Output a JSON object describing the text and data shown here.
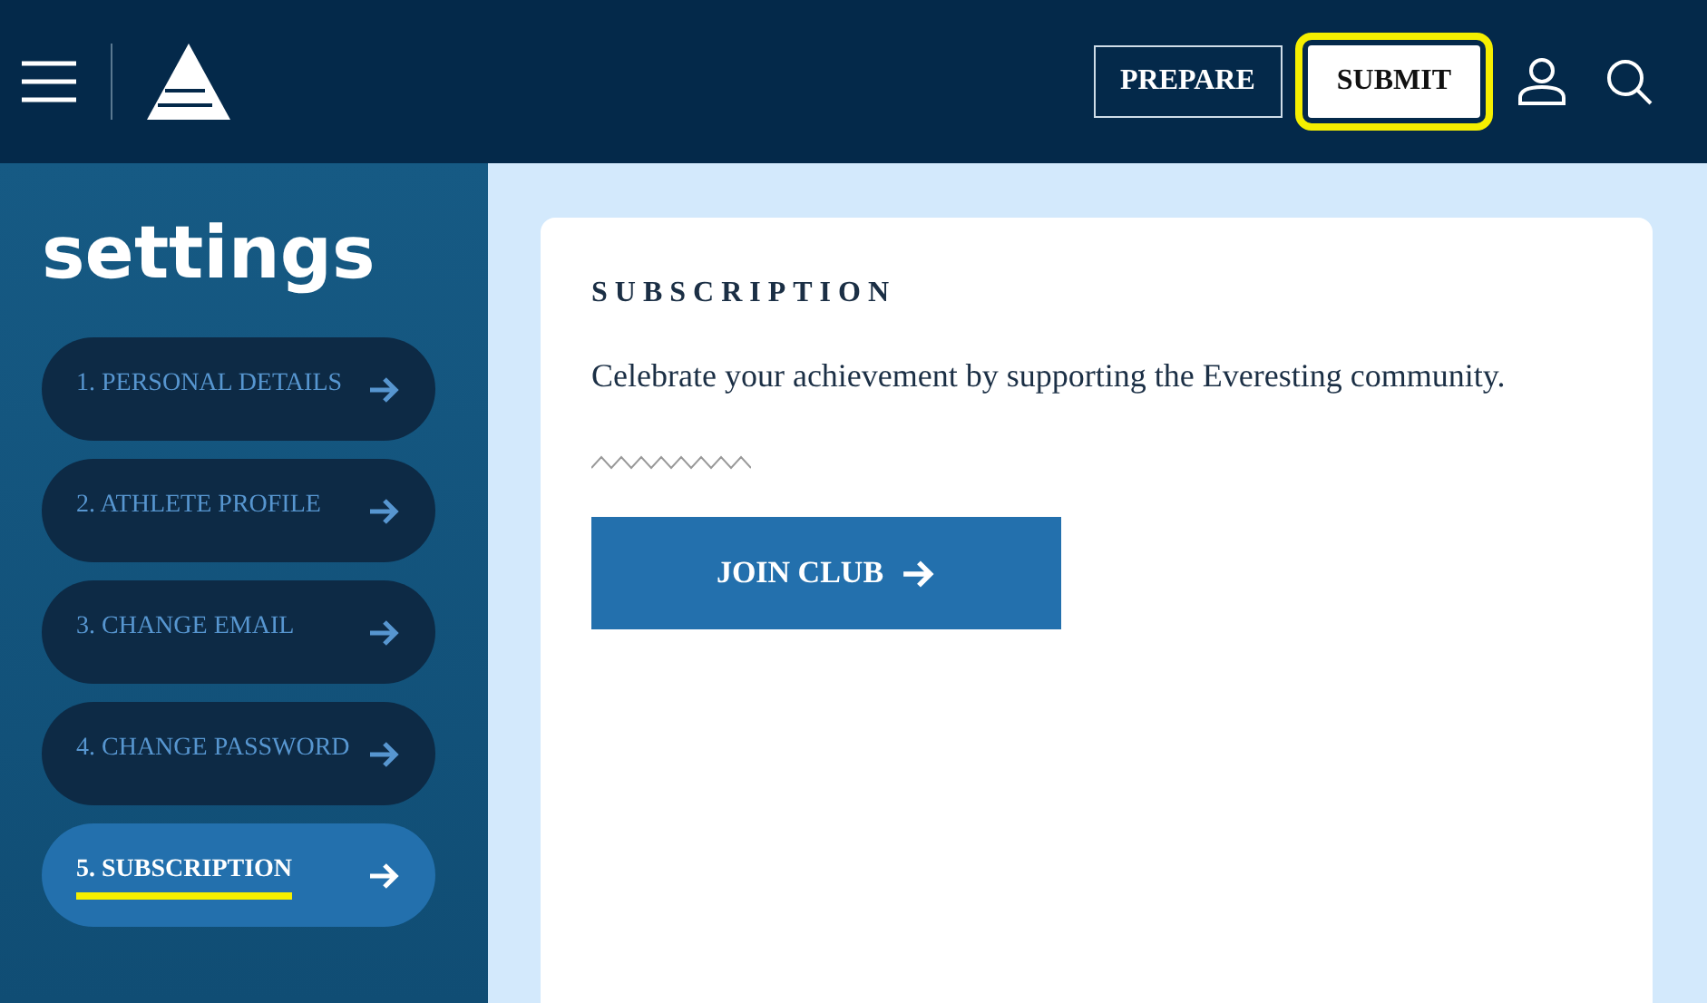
{
  "header": {
    "buttons": [
      {
        "label": "PREPARE",
        "kind": "outline",
        "highlighted": false
      },
      {
        "label": "SUBMIT",
        "kind": "solid",
        "highlighted": true
      }
    ]
  },
  "sidebar": {
    "title": "settings",
    "items": [
      {
        "label": "1. PERSONAL DETAILS",
        "selected": false,
        "highlighted": false
      },
      {
        "label": "2. ATHLETE PROFILE",
        "selected": false,
        "highlighted": false
      },
      {
        "label": "3. CHANGE EMAIL",
        "selected": false,
        "highlighted": false
      },
      {
        "label": "4. CHANGE PASSWORD",
        "selected": false,
        "highlighted": false
      },
      {
        "label": "5. SUBSCRIPTION",
        "selected": true,
        "highlighted": true
      }
    ]
  },
  "card": {
    "heading": "SUBSCRIPTION",
    "text": "Celebrate your achievement by supporting the Everesting community.",
    "button": "JOIN CLUB"
  }
}
